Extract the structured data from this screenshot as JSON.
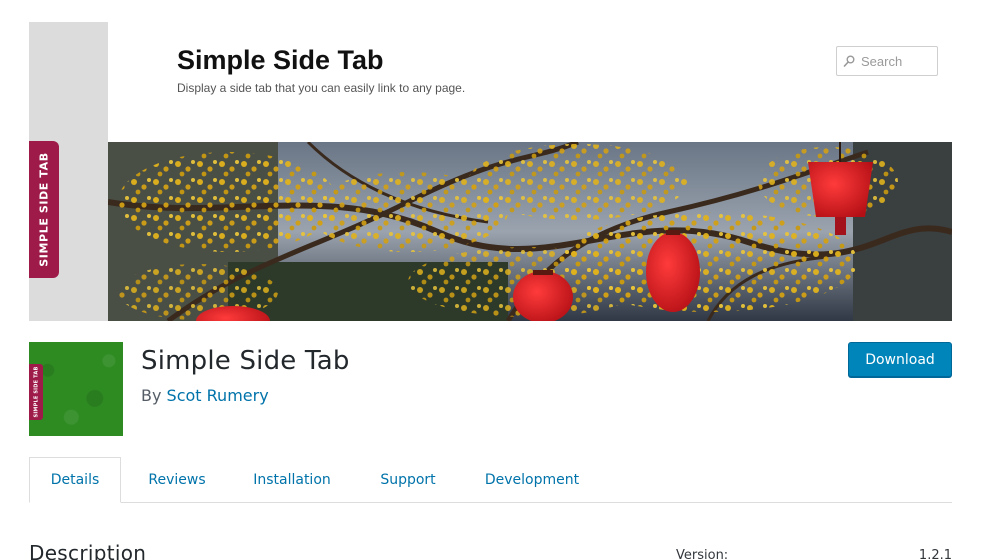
{
  "banner": {
    "site_title": "Simple Side Tab",
    "tagline": "Display a side tab that you can easily link to any page.",
    "side_tab_label": "SIMPLE SIDE TAB",
    "search_placeholder": "Search"
  },
  "plugin": {
    "icon_tab_label": "SIMPLE SIDE TAB",
    "name": "Simple Side Tab",
    "by_prefix": "By",
    "author": "Scot Rumery",
    "download_label": "Download"
  },
  "tabs": [
    {
      "label": "Details",
      "active": true
    },
    {
      "label": "Reviews",
      "active": false
    },
    {
      "label": "Installation",
      "active": false
    },
    {
      "label": "Support",
      "active": false
    },
    {
      "label": "Development",
      "active": false
    }
  ],
  "description": {
    "heading": "Description"
  },
  "meta": {
    "version_label": "Version:",
    "version_value": "1.2.1"
  },
  "colors": {
    "link": "#0073aa",
    "primary_button": "#0085ba",
    "side_tab": "#9e1b49",
    "plugin_icon_bg": "#2e8b22"
  }
}
